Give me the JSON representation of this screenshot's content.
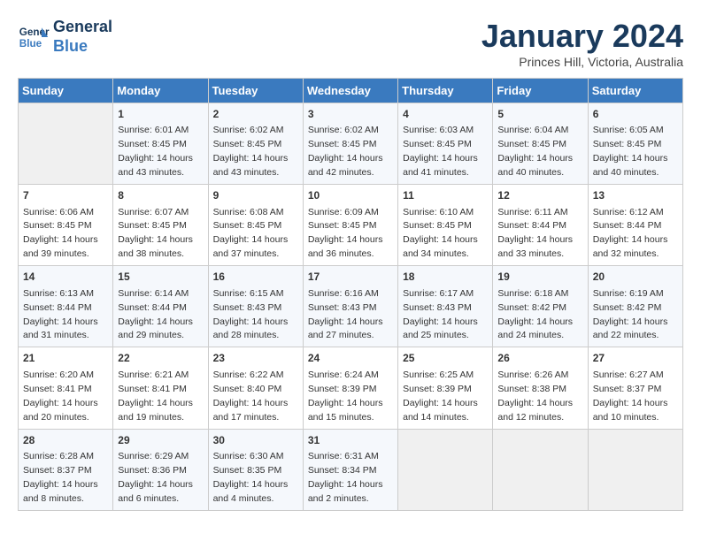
{
  "header": {
    "logo_line1": "General",
    "logo_line2": "Blue",
    "month": "January 2024",
    "location": "Princes Hill, Victoria, Australia"
  },
  "weekdays": [
    "Sunday",
    "Monday",
    "Tuesday",
    "Wednesday",
    "Thursday",
    "Friday",
    "Saturday"
  ],
  "weeks": [
    [
      {
        "day": "",
        "sunrise": "",
        "sunset": "",
        "daylight": ""
      },
      {
        "day": "1",
        "sunrise": "6:01 AM",
        "sunset": "8:45 PM",
        "daylight": "14 hours and 43 minutes."
      },
      {
        "day": "2",
        "sunrise": "6:02 AM",
        "sunset": "8:45 PM",
        "daylight": "14 hours and 43 minutes."
      },
      {
        "day": "3",
        "sunrise": "6:02 AM",
        "sunset": "8:45 PM",
        "daylight": "14 hours and 42 minutes."
      },
      {
        "day": "4",
        "sunrise": "6:03 AM",
        "sunset": "8:45 PM",
        "daylight": "14 hours and 41 minutes."
      },
      {
        "day": "5",
        "sunrise": "6:04 AM",
        "sunset": "8:45 PM",
        "daylight": "14 hours and 40 minutes."
      },
      {
        "day": "6",
        "sunrise": "6:05 AM",
        "sunset": "8:45 PM",
        "daylight": "14 hours and 40 minutes."
      }
    ],
    [
      {
        "day": "7",
        "sunrise": "6:06 AM",
        "sunset": "8:45 PM",
        "daylight": "14 hours and 39 minutes."
      },
      {
        "day": "8",
        "sunrise": "6:07 AM",
        "sunset": "8:45 PM",
        "daylight": "14 hours and 38 minutes."
      },
      {
        "day": "9",
        "sunrise": "6:08 AM",
        "sunset": "8:45 PM",
        "daylight": "14 hours and 37 minutes."
      },
      {
        "day": "10",
        "sunrise": "6:09 AM",
        "sunset": "8:45 PM",
        "daylight": "14 hours and 36 minutes."
      },
      {
        "day": "11",
        "sunrise": "6:10 AM",
        "sunset": "8:45 PM",
        "daylight": "14 hours and 34 minutes."
      },
      {
        "day": "12",
        "sunrise": "6:11 AM",
        "sunset": "8:44 PM",
        "daylight": "14 hours and 33 minutes."
      },
      {
        "day": "13",
        "sunrise": "6:12 AM",
        "sunset": "8:44 PM",
        "daylight": "14 hours and 32 minutes."
      }
    ],
    [
      {
        "day": "14",
        "sunrise": "6:13 AM",
        "sunset": "8:44 PM",
        "daylight": "14 hours and 31 minutes."
      },
      {
        "day": "15",
        "sunrise": "6:14 AM",
        "sunset": "8:44 PM",
        "daylight": "14 hours and 29 minutes."
      },
      {
        "day": "16",
        "sunrise": "6:15 AM",
        "sunset": "8:43 PM",
        "daylight": "14 hours and 28 minutes."
      },
      {
        "day": "17",
        "sunrise": "6:16 AM",
        "sunset": "8:43 PM",
        "daylight": "14 hours and 27 minutes."
      },
      {
        "day": "18",
        "sunrise": "6:17 AM",
        "sunset": "8:43 PM",
        "daylight": "14 hours and 25 minutes."
      },
      {
        "day": "19",
        "sunrise": "6:18 AM",
        "sunset": "8:42 PM",
        "daylight": "14 hours and 24 minutes."
      },
      {
        "day": "20",
        "sunrise": "6:19 AM",
        "sunset": "8:42 PM",
        "daylight": "14 hours and 22 minutes."
      }
    ],
    [
      {
        "day": "21",
        "sunrise": "6:20 AM",
        "sunset": "8:41 PM",
        "daylight": "14 hours and 20 minutes."
      },
      {
        "day": "22",
        "sunrise": "6:21 AM",
        "sunset": "8:41 PM",
        "daylight": "14 hours and 19 minutes."
      },
      {
        "day": "23",
        "sunrise": "6:22 AM",
        "sunset": "8:40 PM",
        "daylight": "14 hours and 17 minutes."
      },
      {
        "day": "24",
        "sunrise": "6:24 AM",
        "sunset": "8:39 PM",
        "daylight": "14 hours and 15 minutes."
      },
      {
        "day": "25",
        "sunrise": "6:25 AM",
        "sunset": "8:39 PM",
        "daylight": "14 hours and 14 minutes."
      },
      {
        "day": "26",
        "sunrise": "6:26 AM",
        "sunset": "8:38 PM",
        "daylight": "14 hours and 12 minutes."
      },
      {
        "day": "27",
        "sunrise": "6:27 AM",
        "sunset": "8:37 PM",
        "daylight": "14 hours and 10 minutes."
      }
    ],
    [
      {
        "day": "28",
        "sunrise": "6:28 AM",
        "sunset": "8:37 PM",
        "daylight": "14 hours and 8 minutes."
      },
      {
        "day": "29",
        "sunrise": "6:29 AM",
        "sunset": "8:36 PM",
        "daylight": "14 hours and 6 minutes."
      },
      {
        "day": "30",
        "sunrise": "6:30 AM",
        "sunset": "8:35 PM",
        "daylight": "14 hours and 4 minutes."
      },
      {
        "day": "31",
        "sunrise": "6:31 AM",
        "sunset": "8:34 PM",
        "daylight": "14 hours and 2 minutes."
      },
      {
        "day": "",
        "sunrise": "",
        "sunset": "",
        "daylight": ""
      },
      {
        "day": "",
        "sunrise": "",
        "sunset": "",
        "daylight": ""
      },
      {
        "day": "",
        "sunrise": "",
        "sunset": "",
        "daylight": ""
      }
    ]
  ]
}
